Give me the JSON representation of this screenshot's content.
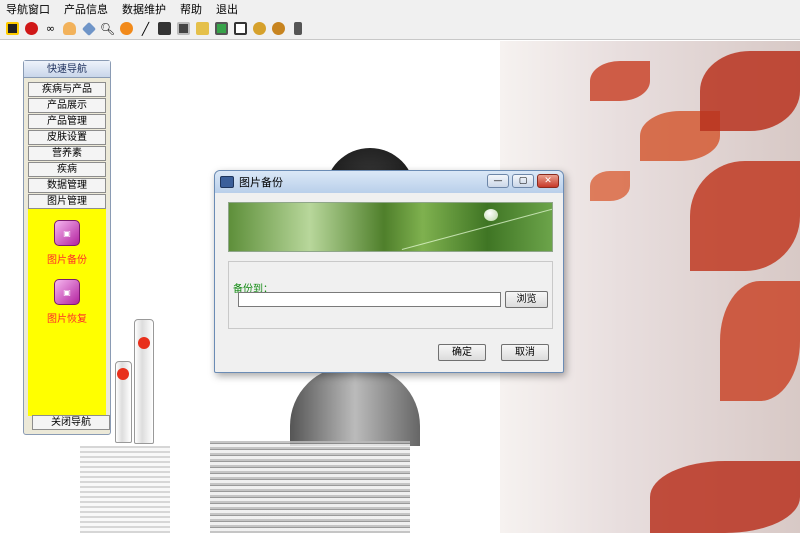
{
  "menu": [
    "导航窗口",
    "产品信息",
    "数据维护",
    "帮助",
    "退出"
  ],
  "toolbar": {
    "icons": [
      "save-icon",
      "stop-icon",
      "glasses-icon",
      "hand-icon",
      "cube-icon",
      "search-icon",
      "fruit-icon",
      "wand-icon",
      "disk-icon",
      "disk-icon",
      "folder-icon",
      "monitor-icon",
      "box-icon",
      "users-icon",
      "users-icon",
      "exit-icon"
    ]
  },
  "nav": {
    "title": "快速导航",
    "items": [
      "疾病与产品",
      "产品展示",
      "产品管理",
      "皮肤设置",
      "营养素",
      "疾病",
      "数据管理",
      "图片管理"
    ],
    "tools": [
      {
        "label": "图片备份",
        "icon": "backup-icon"
      },
      {
        "label": "图片恢复",
        "icon": "restore-icon"
      }
    ],
    "close_label": "关闭导航"
  },
  "dialog": {
    "title": "图片备份",
    "backup_label": "备份到：",
    "path_value": "",
    "browse_label": "浏览",
    "ok_label": "确定",
    "cancel_label": "取消"
  },
  "colors": {
    "nav_highlight": "#ffff00",
    "tool_label": "#ff2a2a",
    "group_label": "#108a10"
  }
}
